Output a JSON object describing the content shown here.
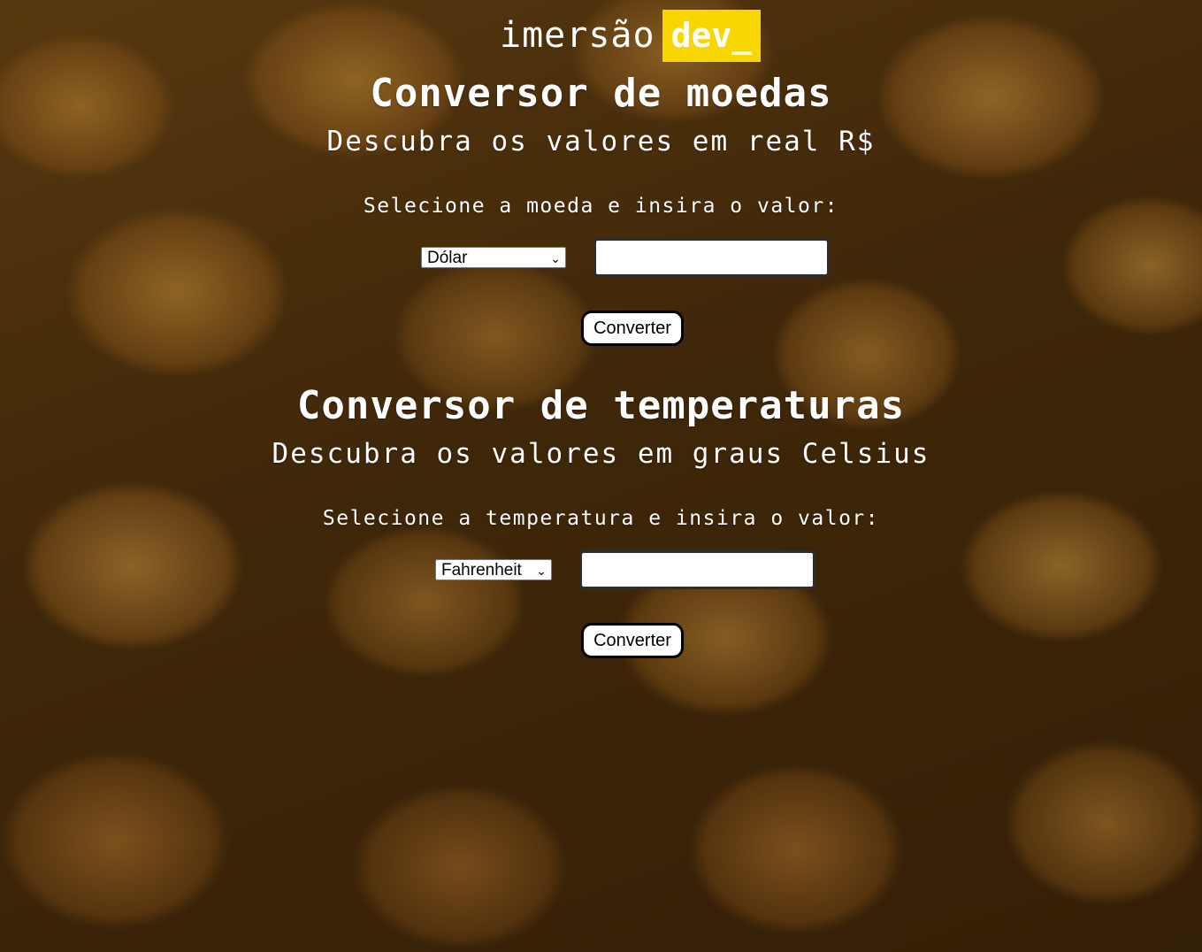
{
  "logo": {
    "word": "imersão",
    "badge": "dev_",
    "badge_color": "#f8d600"
  },
  "currency": {
    "title": "Conversor de moedas",
    "subtitle": "Descubra os valores em real R$",
    "prompt": "Selecione a moeda e insira o valor:",
    "select_value": "Dólar",
    "input_value": "",
    "button_label": "Converter"
  },
  "temperature": {
    "title": "Conversor de temperaturas",
    "subtitle": "Descubra os valores em graus Celsius",
    "prompt": "Selecione a temperatura e insira o valor:",
    "select_value": "Fahrenheit",
    "input_value": "",
    "button_label": "Converter"
  },
  "icons": {
    "dropdown": "chevron-down-icon"
  },
  "colors": {
    "text": "#ffffff",
    "background": "#4a2e0c"
  }
}
